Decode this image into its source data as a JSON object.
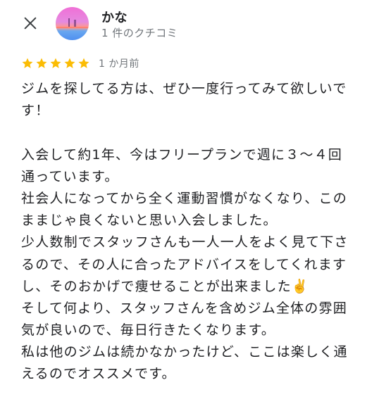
{
  "header": {
    "close_icon": "close-icon",
    "reviewer_name": "かな",
    "review_count": "1 件のクチコミ"
  },
  "rating": {
    "stars": 5,
    "max_stars": 5,
    "star_color": "#fbbc04",
    "date": "1 か月前"
  },
  "review": {
    "lines": [
      "ジムを探してる方は、ぜひ一度行ってみて欲しいで",
      "す！",
      "",
      "入会して約1年、今はフリープランで週に３〜４回",
      "通っています。",
      "社会人になってから全く運動習慣がなくなり、この",
      "ままじゃ良くないと思い入会しました。",
      "少人数制でスタッフさんも一人一人をよく見て下さ",
      "るので、その人に合ったアドバイスをしてくれます",
      "し、そのおかげで痩せることが出来ました✌️",
      "そして何より、スタッフさんを含めジム全体の雰囲",
      "気が良いので、毎日行きたくなります。",
      "私は他のジムは続かなかったけど、ここは楽しく通",
      "えるのでオススメです。"
    ]
  }
}
